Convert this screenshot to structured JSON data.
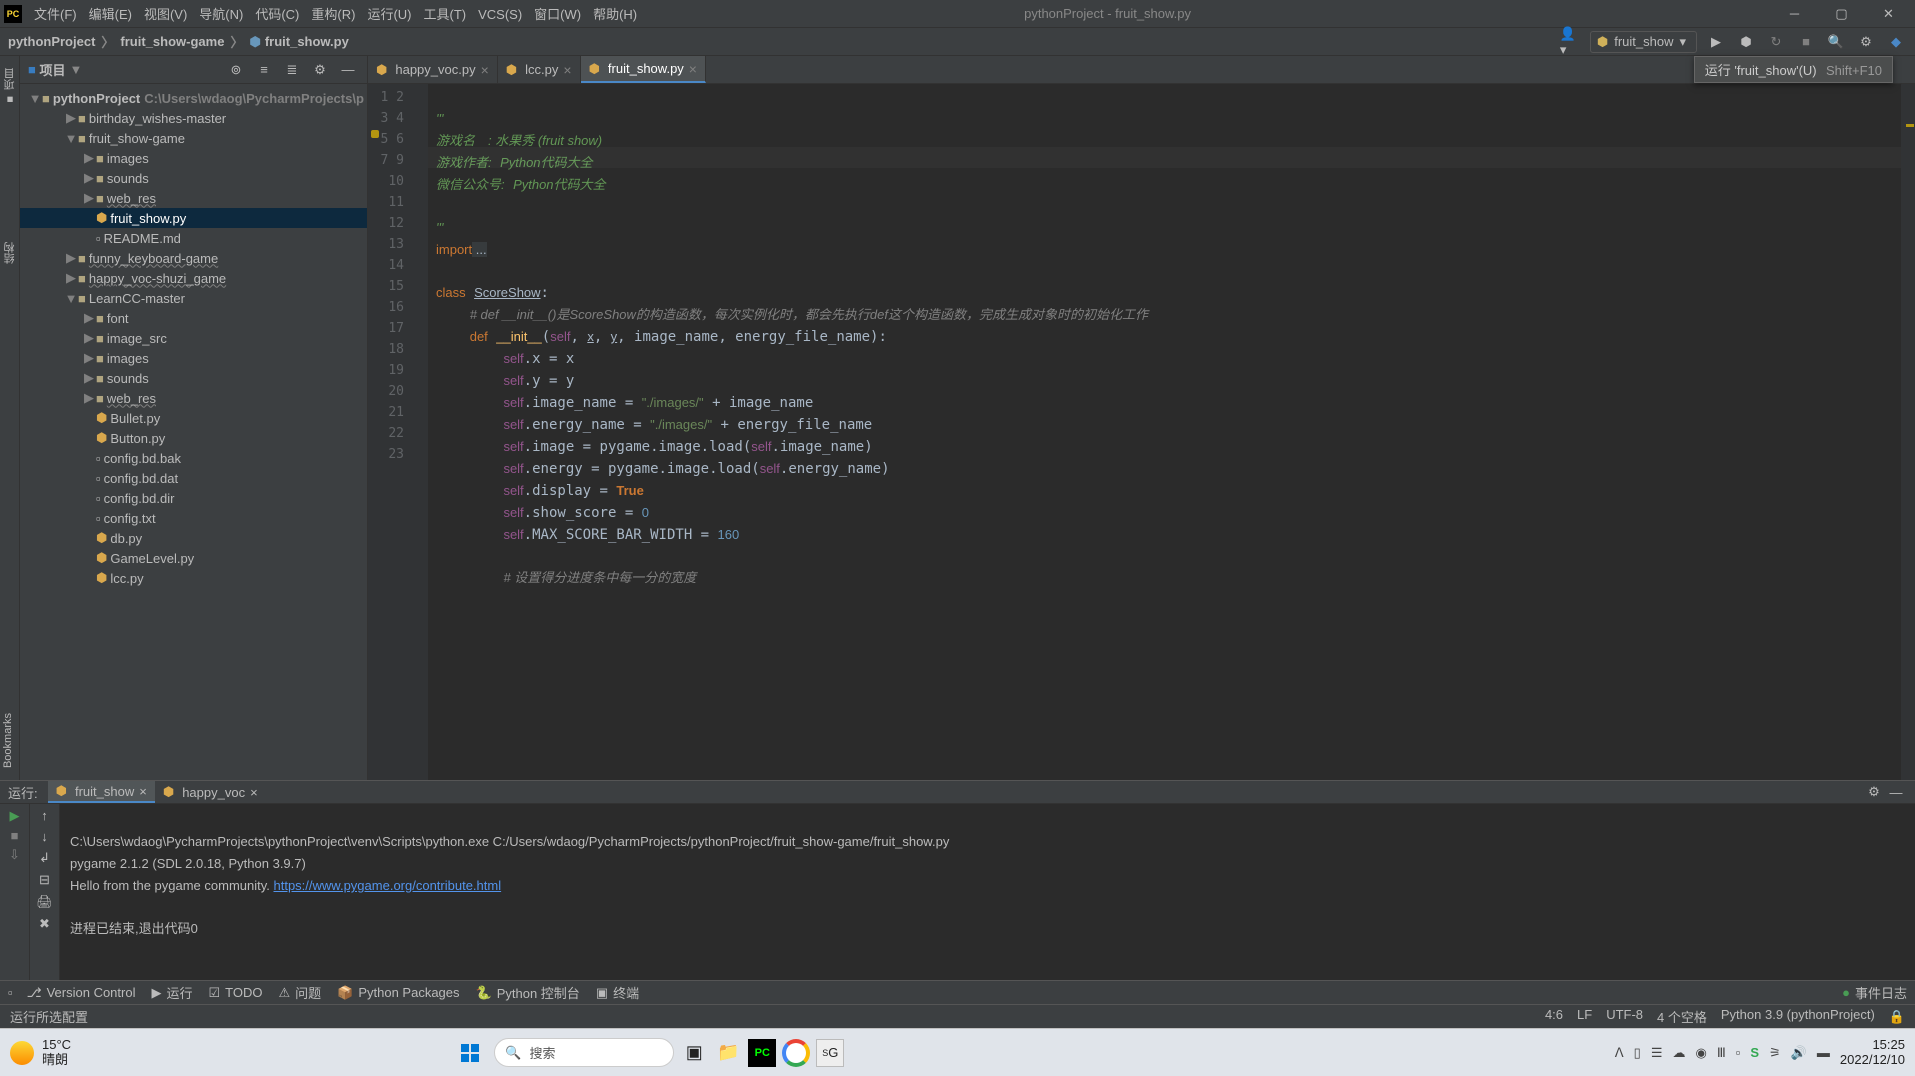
{
  "window_title": "pythonProject - fruit_show.py",
  "menu": [
    "文件(F)",
    "编辑(E)",
    "视图(V)",
    "导航(N)",
    "代码(C)",
    "重构(R)",
    "运行(U)",
    "工具(T)",
    "VCS(S)",
    "窗口(W)",
    "帮助(H)"
  ],
  "breadcrumb": {
    "root": "pythonProject",
    "folder": "fruit_show-game",
    "file": "fruit_show.py"
  },
  "run_config_name": "fruit_show",
  "tooltip_text": "运行 'fruit_show'(U)",
  "tooltip_shortcut": "Shift+F10",
  "project_title": "项目",
  "tree": {
    "root_name": "pythonProject",
    "root_path": "C:\\Users\\wdaog\\PycharmProjects\\p",
    "children": [
      {
        "name": "birthday_wishes-master",
        "depth": 2,
        "chev": "▶",
        "type": "folder"
      },
      {
        "name": "fruit_show-game",
        "depth": 2,
        "chev": "▼",
        "type": "folder"
      },
      {
        "name": "images",
        "depth": 3,
        "chev": "▶",
        "type": "folder"
      },
      {
        "name": "sounds",
        "depth": 3,
        "chev": "▶",
        "type": "folder"
      },
      {
        "name": "web_res",
        "depth": 3,
        "chev": "▶",
        "type": "folder",
        "excluded": true
      },
      {
        "name": "fruit_show.py",
        "depth": 3,
        "chev": "",
        "type": "py",
        "selected": true
      },
      {
        "name": "README.md",
        "depth": 3,
        "chev": "",
        "type": "txt"
      },
      {
        "name": "funny_keyboard-game",
        "depth": 2,
        "chev": "▶",
        "type": "folder",
        "excluded": true
      },
      {
        "name": "happy_voc-shuzi_game",
        "depth": 2,
        "chev": "▶",
        "type": "folder",
        "excluded": true
      },
      {
        "name": "LearnCC-master",
        "depth": 2,
        "chev": "▼",
        "type": "folder"
      },
      {
        "name": "font",
        "depth": 3,
        "chev": "▶",
        "type": "folder"
      },
      {
        "name": "image_src",
        "depth": 3,
        "chev": "▶",
        "type": "folder"
      },
      {
        "name": "images",
        "depth": 3,
        "chev": "▶",
        "type": "folder"
      },
      {
        "name": "sounds",
        "depth": 3,
        "chev": "▶",
        "type": "folder"
      },
      {
        "name": "web_res",
        "depth": 3,
        "chev": "▶",
        "type": "folder",
        "excluded": true
      },
      {
        "name": "Bullet.py",
        "depth": 3,
        "chev": "",
        "type": "py"
      },
      {
        "name": "Button.py",
        "depth": 3,
        "chev": "",
        "type": "py"
      },
      {
        "name": "config.bd.bak",
        "depth": 3,
        "chev": "",
        "type": "txt"
      },
      {
        "name": "config.bd.dat",
        "depth": 3,
        "chev": "",
        "type": "txt"
      },
      {
        "name": "config.bd.dir",
        "depth": 3,
        "chev": "",
        "type": "txt"
      },
      {
        "name": "config.txt",
        "depth": 3,
        "chev": "",
        "type": "txt"
      },
      {
        "name": "db.py",
        "depth": 3,
        "chev": "",
        "type": "py"
      },
      {
        "name": "GameLevel.py",
        "depth": 3,
        "chev": "",
        "type": "py"
      },
      {
        "name": "lcc.py",
        "depth": 3,
        "chev": "",
        "type": "py"
      }
    ]
  },
  "tabs": [
    {
      "label": "happy_voc.py",
      "active": false
    },
    {
      "label": "lcc.py",
      "active": false
    },
    {
      "label": "fruit_show.py",
      "active": true
    }
  ],
  "line_numbers": [
    1,
    2,
    3,
    4,
    5,
    6,
    7,
    9,
    10,
    11,
    12,
    13,
    14,
    15,
    16,
    17,
    18,
    19,
    20,
    21,
    22,
    23
  ],
  "run_panel": {
    "label": "运行:",
    "tabs": [
      {
        "label": "fruit_show",
        "active": true
      },
      {
        "label": "happy_voc",
        "active": false
      }
    ],
    "line1": "C:\\Users\\wdaog\\PycharmProjects\\pythonProject\\venv\\Scripts\\python.exe C:/Users/wdaog/PycharmProjects/pythonProject/fruit_show-game/fruit_show.py",
    "line2": "pygame 2.1.2 (SDL 2.0.18, Python 3.9.7)",
    "line3a": "Hello from the pygame community. ",
    "line3b": "https://www.pygame.org/contribute.html",
    "line4": "进程已结束,退出代码0"
  },
  "bottom_tools": [
    "Version Control",
    "运行",
    "TODO",
    "问题",
    "Python Packages",
    "Python 控制台",
    "终端"
  ],
  "event_log": "事件日志",
  "status_left": "运行所选配置",
  "status_right": [
    "4:6",
    "LF",
    "UTF-8",
    "4 个空格",
    "Python 3.9 (pythonProject)"
  ],
  "taskbar": {
    "weather_temp": "15°C",
    "weather_desc": "晴朗",
    "search_placeholder": "搜索",
    "time": "15:25",
    "date": "2022/12/10"
  }
}
